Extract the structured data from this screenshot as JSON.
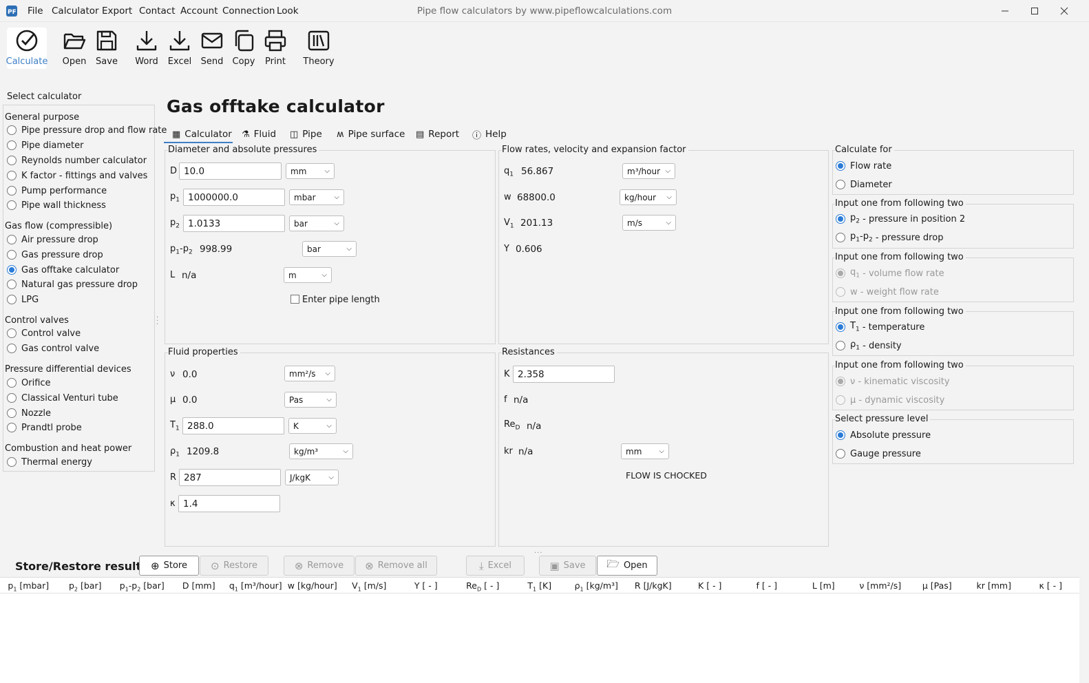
{
  "menu": [
    "File",
    "Calculator",
    "Export",
    "Contact",
    "Account",
    "Connection",
    "Look"
  ],
  "window_title": "Pipe flow calculators by www.pipeflowcalculations.com",
  "toolbar": {
    "calculate": "Calculate",
    "open": "Open",
    "save": "Save",
    "word": "Word",
    "excel": "Excel",
    "send": "Send",
    "copy": "Copy",
    "print": "Print",
    "theory": "Theory"
  },
  "sidebar": {
    "title": "Select calculator",
    "groups": [
      {
        "label": "General purpose",
        "items": [
          "Pipe pressure drop and flow rate",
          "Pipe diameter",
          "Reynolds number calculator",
          "K factor - fittings and valves",
          "Pump performance",
          "Pipe wall thickness"
        ]
      },
      {
        "label": "Gas flow (compressible)",
        "items": [
          "Air pressure drop",
          "Gas pressure drop",
          "Gas offtake calculator",
          "Natural gas pressure drop",
          "LPG"
        ]
      },
      {
        "label": "Control valves",
        "items": [
          "Control valve",
          "Gas control valve"
        ]
      },
      {
        "label": "Pressure differential devices",
        "items": [
          "Orifice",
          "Classical Venturi tube",
          "Nozzle",
          "Prandtl probe"
        ]
      },
      {
        "label": "Combustion and heat power",
        "items": [
          "Thermal energy"
        ]
      }
    ],
    "selected": "Gas offtake calculator"
  },
  "main_title": "Gas offtake calculator",
  "tabs": [
    "Calculator",
    "Fluid",
    "Pipe",
    "Pipe surface",
    "Report",
    "Help"
  ],
  "diameter_panel": {
    "title": "Diameter and absolute pressures",
    "D": {
      "label": "D",
      "value": "10.0",
      "unit": "mm"
    },
    "p1": {
      "value": "1000000.0",
      "unit": "mbar"
    },
    "p2": {
      "value": "1.0133",
      "unit": "bar"
    },
    "dp": {
      "value": "998.99",
      "unit": "bar"
    },
    "L": {
      "label": "L",
      "value": "n/a",
      "unit": "m"
    },
    "enter_length": "Enter pipe length"
  },
  "flow_panel": {
    "title": "Flow rates, velocity and expansion factor",
    "q1": {
      "value": "56.867",
      "unit": "m³/hour"
    },
    "w": {
      "label": "w",
      "value": "68800.0",
      "unit": "kg/hour"
    },
    "V1": {
      "value": "201.13",
      "unit": "m/s"
    },
    "Y": {
      "label": "Y",
      "value": "0.606"
    }
  },
  "fluid_panel": {
    "title": "Fluid properties",
    "nu": {
      "label": "ν",
      "value": "0.0",
      "unit": "mm²/s"
    },
    "mu": {
      "label": "μ",
      "value": "0.0",
      "unit": "Pas"
    },
    "T1": {
      "value": "288.0",
      "unit": "K"
    },
    "rho1": {
      "value": "1209.8",
      "unit": "kg/m³"
    },
    "R": {
      "label": "R",
      "value": "287",
      "unit": "J/kgK"
    },
    "kappa": {
      "label": "κ",
      "value": "1.4"
    }
  },
  "resist_panel": {
    "title": "Resistances",
    "K": {
      "label": "K",
      "value": "2.358"
    },
    "f": {
      "label": "f",
      "value": "n/a"
    },
    "Re": {
      "value": "n/a"
    },
    "kr": {
      "label": "kr",
      "value": "n/a",
      "unit": "mm"
    },
    "status": "FLOW IS CHOCKED"
  },
  "options": {
    "calc_for": {
      "title": "Calculate for",
      "a": "Flow rate",
      "b": "Diameter"
    },
    "pressure_input": {
      "title": "Input one from following two",
      "a": "- pressure in position 2",
      "b": "- pressure drop"
    },
    "flow_input": {
      "title": "Input one from following two",
      "a": "- volume flow rate",
      "b": "w - weight flow rate"
    },
    "temp_input": {
      "title": "Input one from following two",
      "a": "- temperature",
      "b": "- density"
    },
    "visc_input": {
      "title": "Input one from following two",
      "a": "ν - kinematic viscosity",
      "b": "μ - dynamic viscosity"
    },
    "pressure_level": {
      "title": "Select pressure level",
      "a": "Absolute pressure",
      "b": "Gauge pressure"
    }
  },
  "store_bar": {
    "title": "Store/Restore results",
    "store": "Store",
    "restore": "Restore",
    "remove": "Remove",
    "remove_all": "Remove all",
    "excel": "Excel",
    "save": "Save",
    "open": "Open"
  },
  "table_headers": [
    "[mbar]",
    "[bar]",
    "[bar]",
    "D [mm]",
    "[m³/hour]",
    "w [kg/hour]",
    "[m/s]",
    "Y [ - ]",
    "[ - ]",
    "[K]",
    "[kg/m³]",
    "R [J/kgK]",
    "K [ - ]",
    "f [ - ]",
    "L [m]",
    "ν [mm²/s]",
    "μ [Pas]",
    "kr [mm]",
    "κ [ - ]"
  ]
}
